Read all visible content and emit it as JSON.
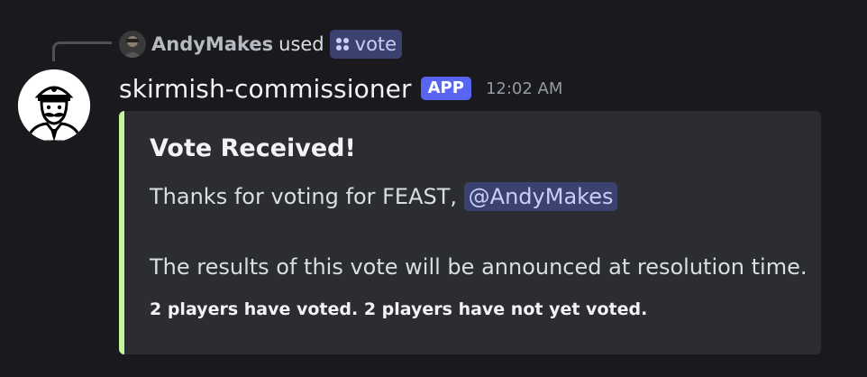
{
  "reply": {
    "author": "AndyMakes",
    "verb": "used",
    "command": "vote"
  },
  "message": {
    "username": "skirmish-commissioner",
    "badge": "APP",
    "timestamp": "12:02 AM"
  },
  "embed": {
    "accent_color": "#c7f59a",
    "title": "Vote Received!",
    "thanks_text": "Thanks for voting for FEAST,",
    "mention": "@AndyMakes",
    "results_text": "The results of this vote will be announced at resolution time.",
    "footer": "2 players have voted. 2 players have not yet voted."
  },
  "colors": {
    "background": "#1a1a1e",
    "badge": "#5865f2",
    "mention_bg": "#3c4270"
  }
}
